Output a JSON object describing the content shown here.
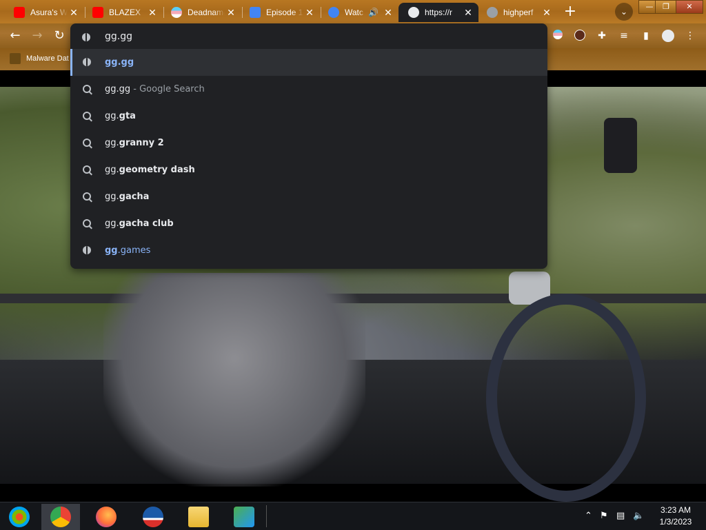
{
  "browser": {
    "tabs": [
      {
        "title": "Asura's W",
        "favicon_color": "#ff0000"
      },
      {
        "title": "BLAZEX",
        "favicon_color": "#ff0000"
      },
      {
        "title": "Deadname",
        "favicon_color": "#f5a9b8"
      },
      {
        "title": "Episode 1",
        "favicon_color": "#4285f4"
      },
      {
        "title": "Watc",
        "favicon_color": "#4285f4"
      },
      {
        "title": "https://r",
        "favicon_color": "#e8eaed"
      },
      {
        "title": "highperf",
        "favicon_color": "#9aa0a6"
      }
    ],
    "close_glyph": "✕",
    "new_tab_glyph": "+",
    "tab_search_glyph": "⌄",
    "window_controls": {
      "minimize": "—",
      "restore": "❐",
      "close": "✕"
    }
  },
  "toolbar": {
    "back_glyph": "←",
    "forward_glyph": "→",
    "reload_glyph": "↻"
  },
  "bookmarks": [
    {
      "label": "Malware Dat"
    }
  ],
  "omnibox": {
    "input_value": "gg.gg",
    "suggestions": [
      {
        "type": "url",
        "icon": "globe-icon",
        "typed": "gg.gg",
        "completion": "",
        "suffix": ""
      },
      {
        "type": "search",
        "icon": "search-icon",
        "typed": "gg.gg",
        "completion": "",
        "suffix": " - Google Search"
      },
      {
        "type": "search",
        "icon": "search-icon",
        "typed": "gg.",
        "completion": "gta",
        "suffix": ""
      },
      {
        "type": "search",
        "icon": "search-icon",
        "typed": "gg.",
        "completion": "granny 2",
        "suffix": ""
      },
      {
        "type": "search",
        "icon": "search-icon",
        "typed": "gg.",
        "completion": "geometry dash",
        "suffix": ""
      },
      {
        "type": "search",
        "icon": "search-icon",
        "typed": "gg.",
        "completion": "gacha",
        "suffix": ""
      },
      {
        "type": "search",
        "icon": "search-icon",
        "typed": "gg.",
        "completion": "gacha club",
        "suffix": ""
      },
      {
        "type": "url",
        "icon": "globe-icon",
        "typed": "gg",
        "completion": ".games",
        "suffix": ""
      }
    ]
  },
  "taskbar": {
    "apps": [
      "windows-start",
      "chrome",
      "firefox",
      "obama",
      "file-explorer",
      "network-app"
    ],
    "clock_time": "3:23 AM",
    "clock_date": "1/3/2023"
  }
}
